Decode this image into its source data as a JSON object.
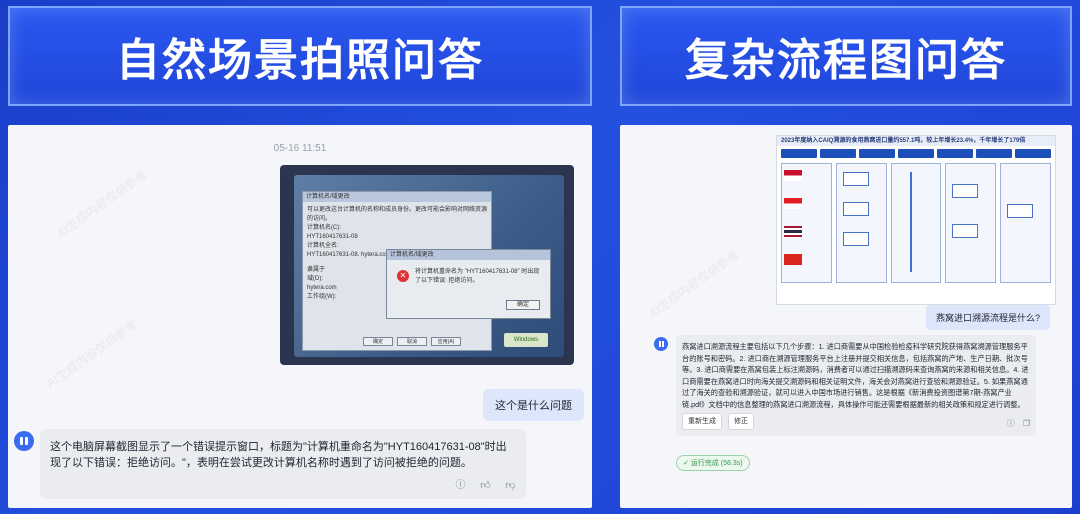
{
  "banners": {
    "left_title": "自然场景拍照问答",
    "right_title": "复杂流程图问答"
  },
  "left_chat": {
    "timestamp": "05-16 11:51",
    "screenshot": {
      "dialog_title": "计算机名/域更改",
      "dialog_lines": [
        "可以更改这台计算机的名称和成员身份。更改可能会影响对网络资源的访问。",
        "计算机名(C):",
        "HYT160417631-08",
        "计算机全名:",
        "HYT160417631-08. hytera.com"
      ],
      "member_label": "隶属于",
      "domain_option": "域(D):",
      "domain_value": "hytera.com",
      "workgroup_option": "工作组(W):",
      "error_dialog_title": "计算机名/域更改",
      "error_text": "将计算机重命名为 \"HYT160417631-08\" 时出现了以下错误: 拒绝访问。",
      "ok_label": "确定",
      "buttons": [
        "确定",
        "取消",
        "应用(A)"
      ],
      "taskbar_label": "Windows"
    },
    "user_message": "这个是什么问题",
    "bot_message": "这个电脑屏幕截图显示了一个错误提示窗口，标题为\"计算机重命名为\"HYT160417631-08\"时出现了以下错误：拒绝访问。\"，表明在尝试更改计算机名称时遇到了访问被拒绝的问题。"
  },
  "right_chat": {
    "flow_title": "2023年度纳入CAIQ溯源的食用燕窝进口量约557.1吨，较上年增长23.4%，千年增长了179倍",
    "user_message": "燕窝进口溯源流程是什么?",
    "bot_message": "燕窝进口溯源流程主要包括以下几个步骤：1. 进口商需要从中国检验检疫科学研究院获得燕窝溯源管理服务平台的账号和密码。2. 进口商在溯源管理服务平台上注册并提交相关信息，包括燕窝的产地、生产日期、批次号等。3. 进口商需要在燕窝包装上标注溯源码，消费者可以通过扫描溯源码来查询燕窝的来源和相关信息。4. 进口商需要在燕窝进口时向海关提交溯源码和相关证明文件，海关会对燕窝进行查验和溯源验证。5. 如果燕窝通过了海关的查验和溯源验证，就可以进入中国市场进行销售。这是根据《新消费投资图谱第7期-燕窝产业链.pdf》文档中的信息整理的燕窝进口溯源流程，具体操作可能还需要根据最新的相关政策和规定进行调整。",
    "regenerate_label": "重新生成",
    "edit_label": "修正",
    "status_label": "运行完成 (56.3s)"
  },
  "colors": {
    "background": "#1f46d8",
    "banner_border": "#7fa6ff",
    "user_bubble": "#dde6fb",
    "bot_bubble": "#ebecf0",
    "accent": "#3a6cf0",
    "status_green": "#2e9a4a"
  },
  "icons": {
    "bot_avatar": "bot-avatar-icon",
    "info": "info-icon",
    "thumb_up": "thumb-up-icon",
    "thumb_down": "thumb-down-icon",
    "copy": "copy-icon",
    "check": "check-icon"
  }
}
